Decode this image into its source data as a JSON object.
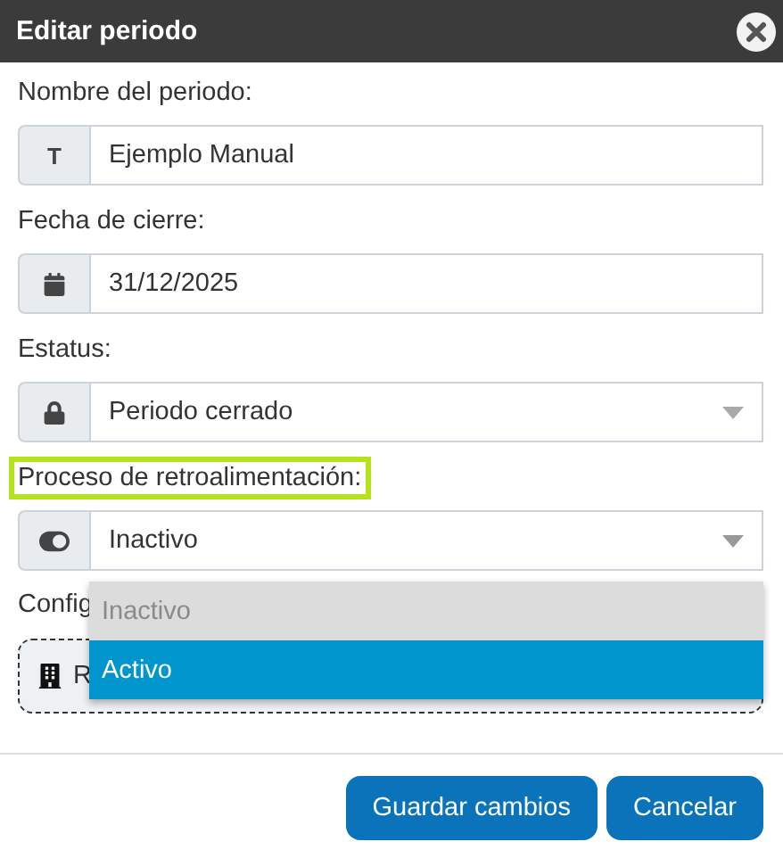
{
  "dialog": {
    "title": "Editar periodo"
  },
  "fields": [
    {
      "label": "Nombre del periodo:",
      "kind": "text",
      "addon_text": "T",
      "value": "Ejemplo Manual",
      "highlighted": false
    },
    {
      "label": "Fecha de cierre:",
      "kind": "date",
      "value": "31/12/2025",
      "highlighted": false
    },
    {
      "label": "Estatus:",
      "kind": "status",
      "value": "Periodo cerrado",
      "highlighted": false,
      "expanded": false
    },
    {
      "label": "Proceso de retroalimentación:",
      "kind": "switch",
      "value": "Inactivo",
      "highlighted": true,
      "expanded": true,
      "options": [
        {
          "label": "Inactivo",
          "selected": true,
          "hovered": false
        },
        {
          "label": "Activo",
          "selected": false,
          "hovered": true
        }
      ]
    }
  ],
  "config_section": {
    "label": "Config",
    "item": "R"
  },
  "buttons": [
    {
      "label": "Guardar cambios"
    },
    {
      "label": "Cancelar"
    }
  ]
}
